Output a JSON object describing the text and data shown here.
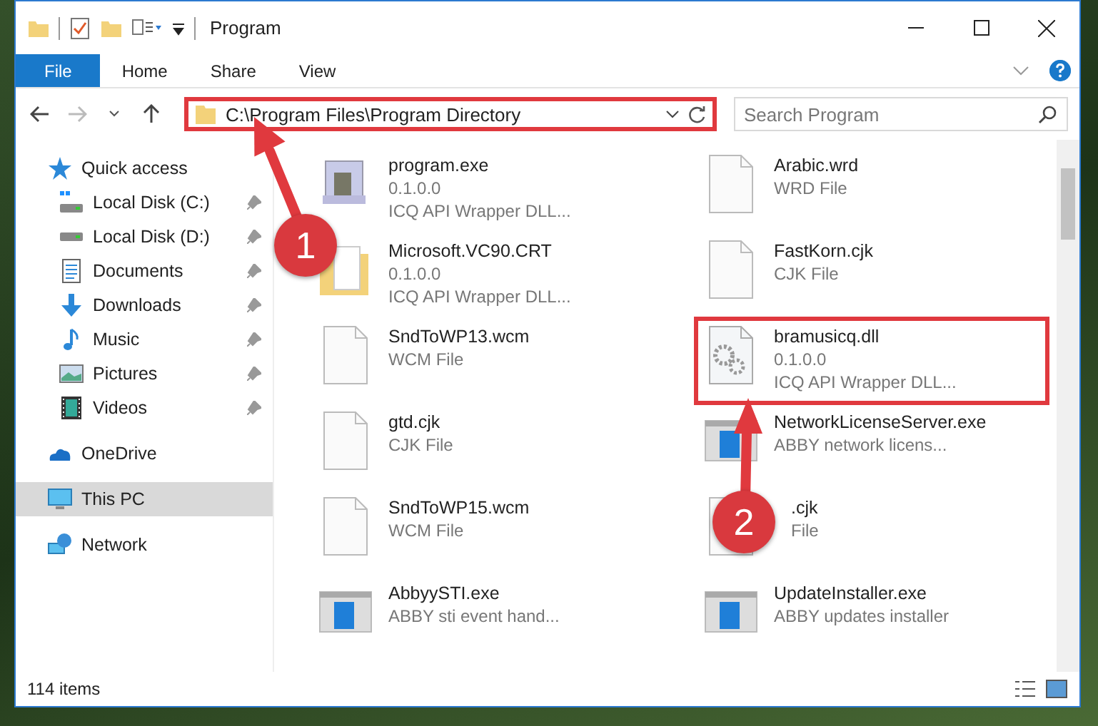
{
  "window": {
    "title": "Program"
  },
  "ribbon": {
    "tabs": [
      {
        "label": "File",
        "selected": true
      },
      {
        "label": "Home",
        "selected": false
      },
      {
        "label": "Share",
        "selected": false
      },
      {
        "label": "View",
        "selected": false
      }
    ]
  },
  "address_bar": {
    "path": "C:\\Program Files\\Program Directory",
    "highlighted": true
  },
  "search": {
    "placeholder": "Search Program"
  },
  "nav": [
    {
      "label": "Quick access",
      "kind": "star",
      "selected": false,
      "children": [
        {
          "label": "Local Disk (C:)",
          "kind": "system-drive",
          "pinned": true,
          "selected": false
        },
        {
          "label": "Local Disk (D:)",
          "kind": "drive",
          "pinned": true,
          "selected": false
        },
        {
          "label": "Documents",
          "kind": "documents",
          "pinned": true,
          "selected": false
        },
        {
          "label": "Downloads",
          "kind": "downloads",
          "pinned": true,
          "selected": false
        },
        {
          "label": "Music",
          "kind": "music",
          "pinned": true,
          "selected": false
        },
        {
          "label": "Pictures",
          "kind": "pictures",
          "pinned": true,
          "selected": false
        },
        {
          "label": "Videos",
          "kind": "videos",
          "pinned": true,
          "selected": false
        }
      ]
    },
    {
      "label": "OneDrive",
      "kind": "cloud",
      "selected": false
    },
    {
      "label": "This PC",
      "kind": "pc",
      "selected": true
    },
    {
      "label": "Network",
      "kind": "network",
      "selected": false
    }
  ],
  "files": [
    {
      "name": "program.exe",
      "details": [
        "0.1.0.0",
        "ICQ API Wrapper DLL..."
      ],
      "kind": "app",
      "highlighted": false
    },
    {
      "name": "Arabic.wrd",
      "details": [
        "WRD File"
      ],
      "kind": "doc",
      "highlighted": false
    },
    {
      "name": "Microsoft.VC90.CRT",
      "details": [
        "0.1.0.0",
        "ICQ API Wrapper DLL..."
      ],
      "kind": "folder-doc",
      "highlighted": false
    },
    {
      "name": "FastKorn.cjk",
      "details": [
        "CJK File"
      ],
      "kind": "doc",
      "highlighted": false
    },
    {
      "name": "SndToWP13.wcm",
      "details": [
        "WCM File"
      ],
      "kind": "doc",
      "highlighted": false
    },
    {
      "name": "bramusicq.dll",
      "details": [
        "0.1.0.0",
        "ICQ API Wrapper DLL..."
      ],
      "kind": "gears",
      "highlighted": true
    },
    {
      "name": "gtd.cjk",
      "details": [
        "CJK File"
      ],
      "kind": "doc",
      "highlighted": false
    },
    {
      "name": "NetworkLicenseServer.exe",
      "details": [
        "ABBY network licens..."
      ],
      "kind": "window",
      "highlighted": false
    },
    {
      "name": "SndToWP15.wcm",
      "details": [
        "WCM File"
      ],
      "kind": "doc",
      "highlighted": false
    },
    {
      "name": ".cjk",
      "details": [
        "File"
      ],
      "kind": "doc",
      "highlighted": false
    },
    {
      "name": "AbbyySTI.exe",
      "details": [
        "ABBY sti event hand..."
      ],
      "kind": "window",
      "highlighted": false
    },
    {
      "name": "UpdateInstaller.exe",
      "details": [
        "ABBY updates installer"
      ],
      "kind": "window",
      "highlighted": false
    }
  ],
  "status_bar": {
    "item_count": "114 items"
  },
  "annotations": [
    {
      "number": "1"
    },
    {
      "number": "2"
    }
  ]
}
